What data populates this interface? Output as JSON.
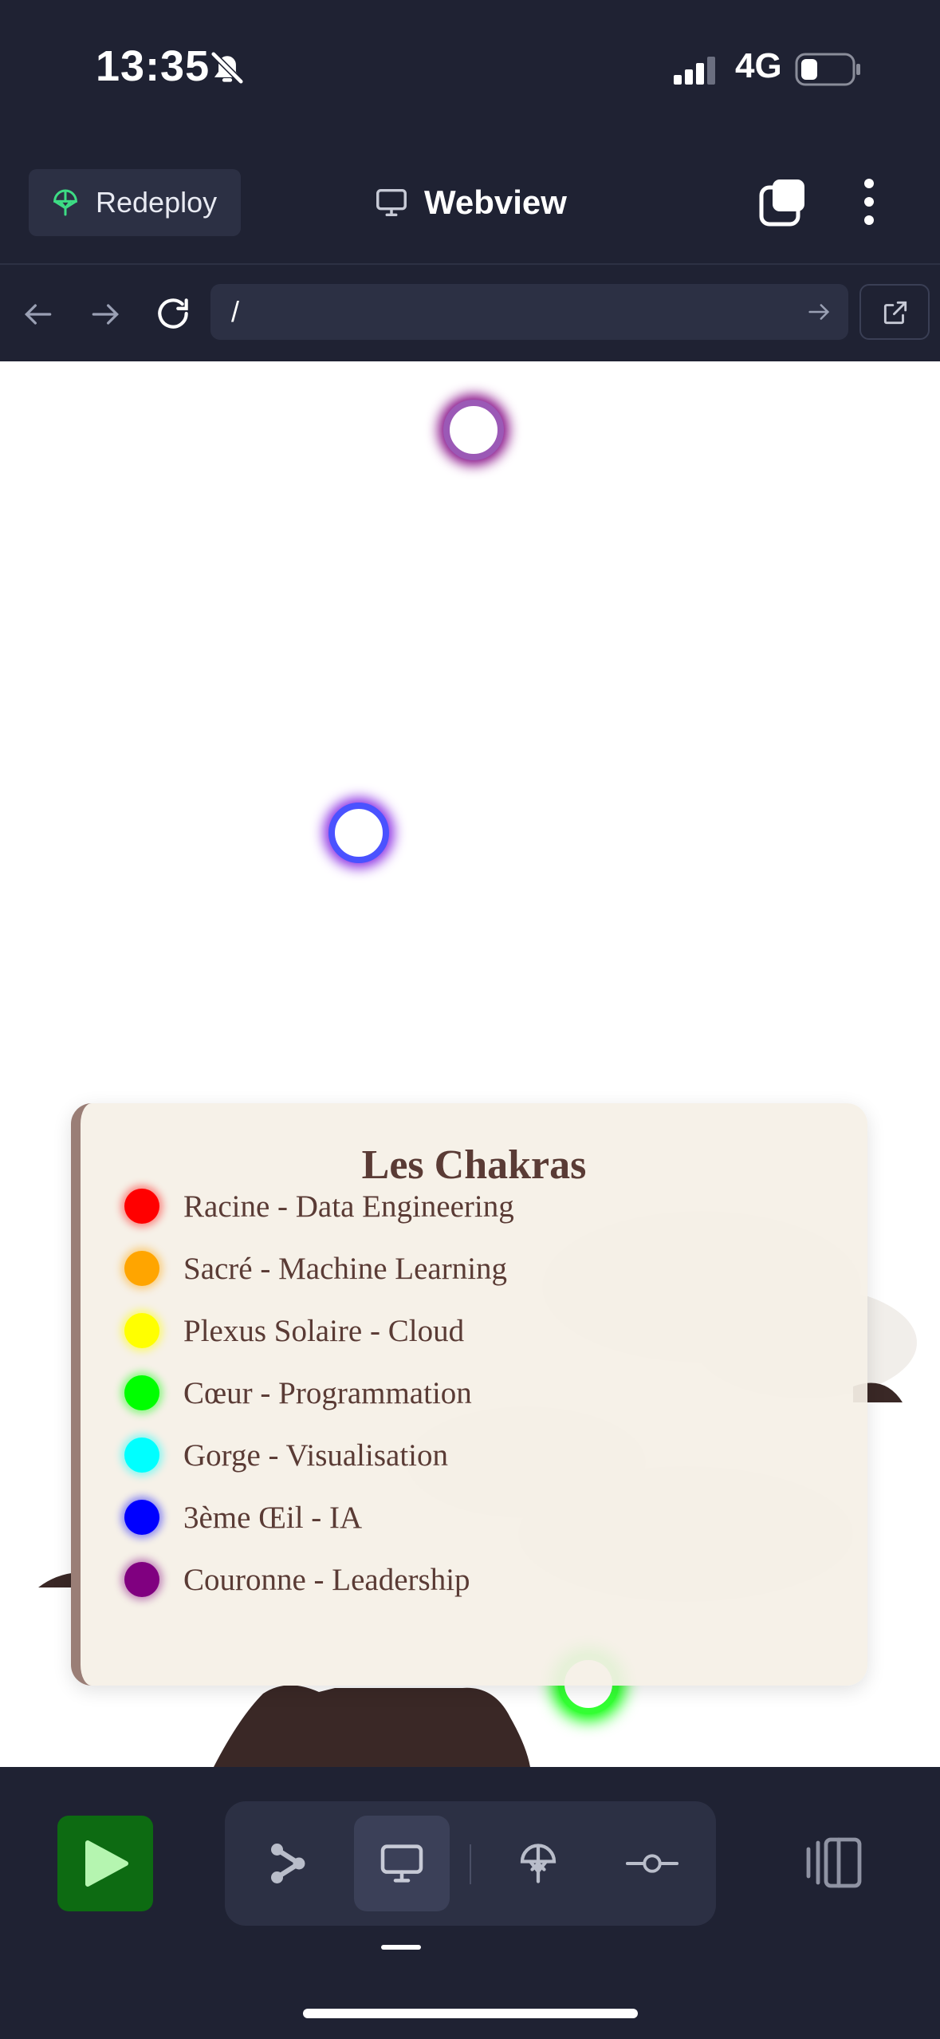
{
  "status_bar": {
    "time": "13:35",
    "network": "4G",
    "icons": [
      "bell-muted-icon",
      "signal-icon",
      "battery-icon"
    ]
  },
  "header": {
    "redeploy_label": "Redeploy",
    "title": "Webview",
    "icons": [
      "redeploy-icon",
      "monitor-icon",
      "tabs-icon",
      "more-vertical-icon"
    ]
  },
  "url_bar": {
    "value": "/",
    "icons": [
      "back-icon",
      "forward-icon",
      "reload-icon",
      "go-arrow-icon",
      "external-link-icon"
    ]
  },
  "legend": {
    "title": "Les Chakras",
    "items": [
      {
        "label": "Racine - Data Engineering",
        "color": "#ff0000"
      },
      {
        "label": "Sacré - Machine Learning",
        "color": "#ffa500"
      },
      {
        "label": "Plexus Solaire - Cloud",
        "color": "#ffff00"
      },
      {
        "label": "Cœur - Programmation",
        "color": "#00ff00"
      },
      {
        "label": "Gorge - Visualisation",
        "color": "#00ffff"
      },
      {
        "label": "3ème Œil - IA",
        "color": "#0000ff"
      },
      {
        "label": "Couronne - Leadership",
        "color": "#800080"
      }
    ]
  },
  "orbs": [
    {
      "name": "crown-chakra-orb",
      "color": "#800080"
    },
    {
      "name": "third-eye-chakra-orb",
      "color": "#0000ff"
    },
    {
      "name": "heart-chakra-orb",
      "color": "#00ff00"
    }
  ],
  "bottom_bar": {
    "icons": [
      "run-icon",
      "graph-icon",
      "webview-icon",
      "deploy-icon",
      "git-commit-icon",
      "sidebar-icon"
    ]
  }
}
